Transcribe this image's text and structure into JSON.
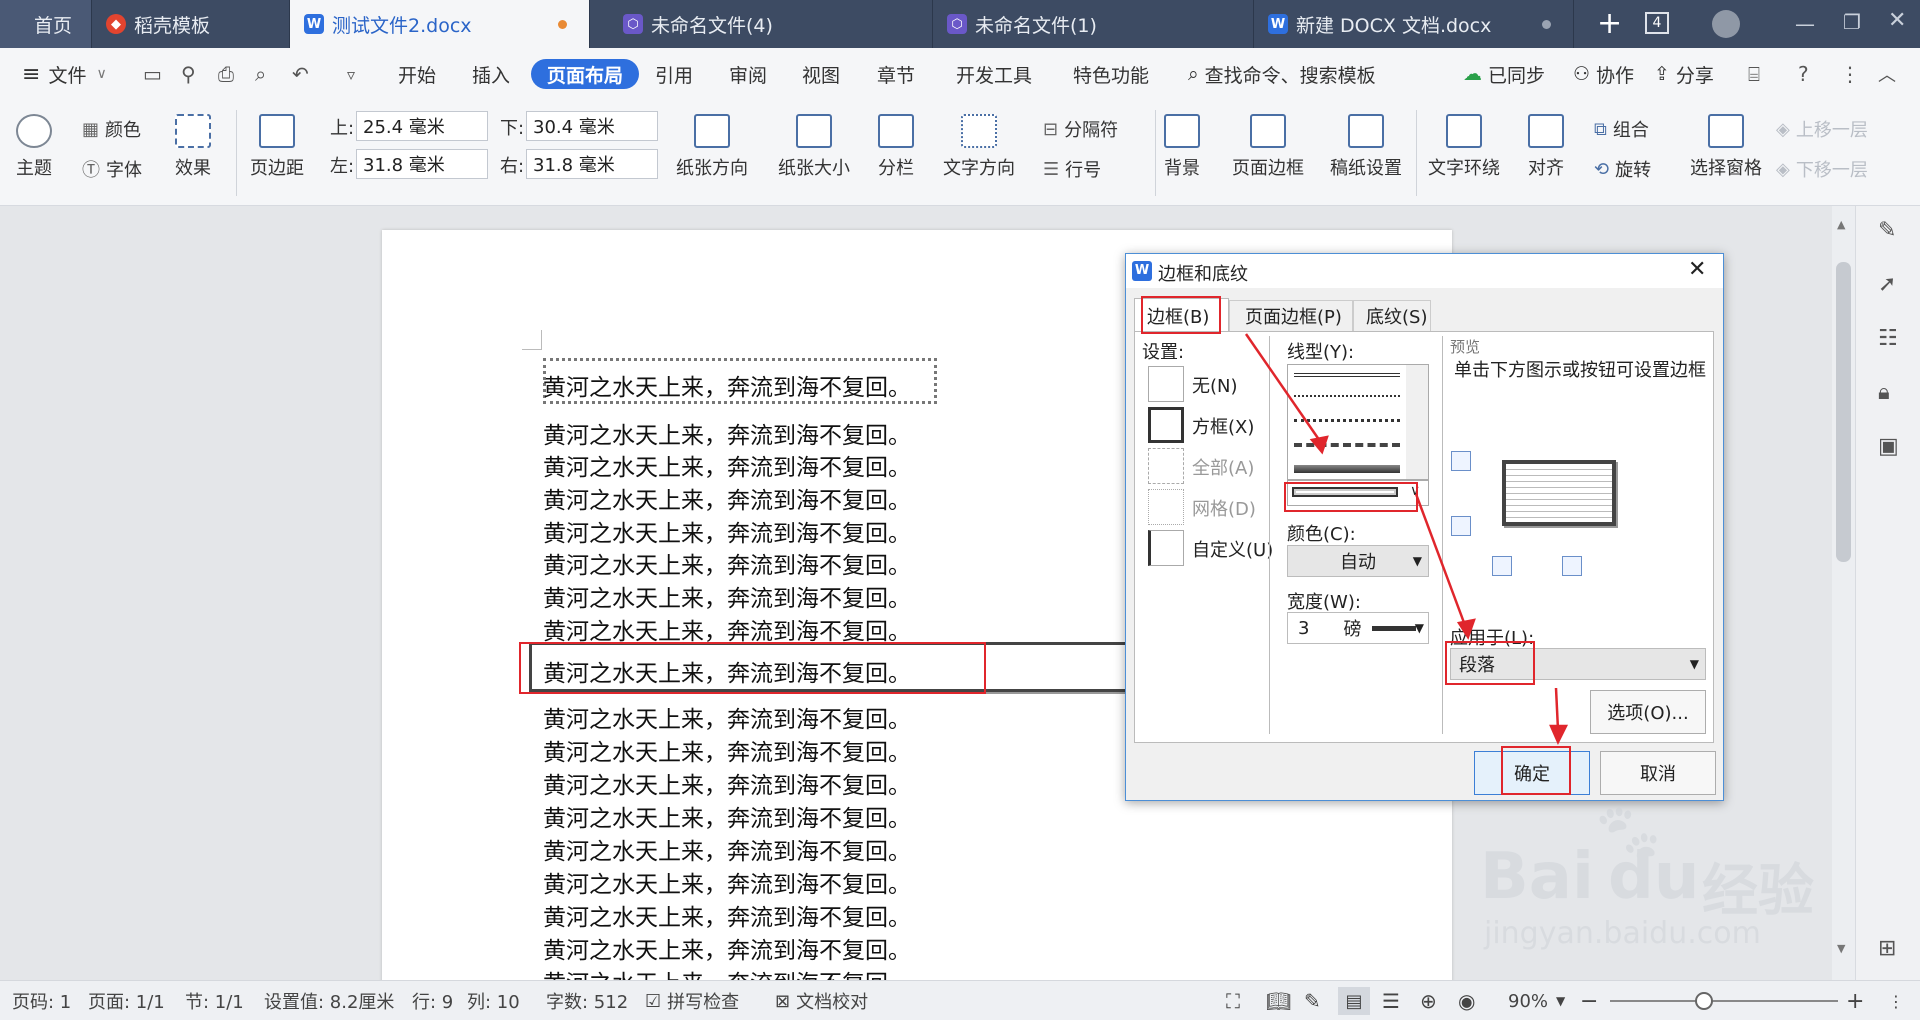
{
  "tabs": [
    {
      "label": "首页"
    },
    {
      "label": "稻壳模板"
    },
    {
      "label": "测试文件2.docx"
    },
    {
      "label": "未命名文件(4)"
    },
    {
      "label": "未命名文件(1)"
    },
    {
      "label": "新建 DOCX 文档.docx"
    }
  ],
  "tabbar": {
    "add": "+",
    "count": "4"
  },
  "menu": {
    "file": "文件",
    "items": [
      "开始",
      "插入",
      "页面布局",
      "引用",
      "审阅",
      "视图",
      "章节",
      "开发工具",
      "特色功能"
    ],
    "search": "查找命令、搜索模板",
    "sync": "已同步",
    "collab": "协作",
    "share": "分享"
  },
  "ribbon": {
    "theme": "主题",
    "color": "颜色",
    "font": "字体",
    "effect": "效果",
    "margin": "页边距",
    "top_label": "上:",
    "top_val": "25.4 毫米",
    "bottom_label": "下:",
    "bottom_val": "30.4 毫米",
    "left_label": "左:",
    "left_val": "31.8 毫米",
    "right_label": "右:",
    "right_val": "31.8 毫米",
    "orientation": "纸张方向",
    "size": "纸张大小",
    "columns": "分栏",
    "direction": "文字方向",
    "breaks": "分隔符",
    "line_no": "行号",
    "background": "背景",
    "page_border": "页面边框",
    "manuscript": "稿纸设置",
    "wrap": "文字环绕",
    "align": "对齐",
    "group": "组合",
    "rotate": "旋转",
    "pane": "选择窗格",
    "up": "上移一层",
    "down": "下移一层"
  },
  "document": {
    "line": "黄河之水天上来，奔流到海不复回。",
    "line_count": 19
  },
  "dialog": {
    "title": "边框和底纹",
    "tabs": [
      "边框(B)",
      "页面边框(P)",
      "底纹(S)"
    ],
    "settings_label": "设置:",
    "settings": [
      "无(N)",
      "方框(X)",
      "全部(A)",
      "网格(D)",
      "自定义(U)"
    ],
    "style_label": "线型(Y):",
    "color_label": "颜色(C):",
    "color_value": "自动",
    "width_label": "宽度(W):",
    "width_value": "3",
    "width_unit": "磅",
    "preview_label": "预览",
    "preview_hint": "单击下方图示或按钮可设置边框",
    "apply_label": "应用于(L):",
    "apply_value": "段落",
    "options": "选项(O)...",
    "ok": "确定",
    "cancel": "取消"
  },
  "status": {
    "page_code": "页码: 1",
    "page": "页面: 1/1",
    "section": "节: 1/1",
    "setting": "设置值: 8.2厘米",
    "row": "行: 9",
    "col": "列: 10",
    "words": "字数: 512",
    "spell": "拼写检查",
    "proof": "文档校对",
    "zoom": "90%"
  },
  "watermark": {
    "brand": "Bai",
    "brand2": "经验",
    "url": "jingyan.baidu.com"
  },
  "colors": {
    "accent": "#2e6fde",
    "tabbar": "#3d4b63",
    "annotation": "#e0262c"
  }
}
